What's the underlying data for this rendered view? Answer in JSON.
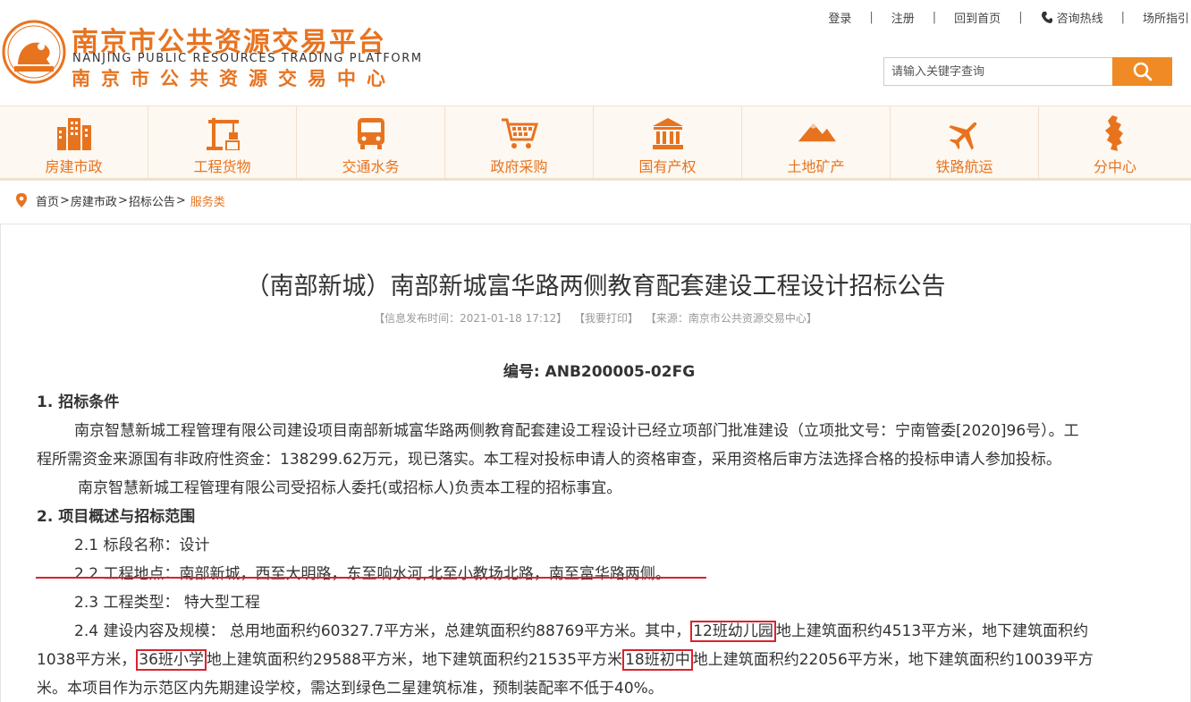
{
  "header": {
    "logo_cn": "南京市公共资源交易平台",
    "logo_en": "NANJING PUBLIC RESOURCES TRADING PLATFORM",
    "logo_sub": "南京市公共资源交易中心",
    "links": {
      "login": "登录",
      "register": "注册",
      "home": "回到首页",
      "hotline": "咨询热线",
      "guide": "场所指引",
      "separator": "|"
    },
    "search_placeholder": "请输入关键字查询"
  },
  "nav": {
    "items": [
      {
        "label": "房建市政",
        "icon": "buildings-icon"
      },
      {
        "label": "工程货物",
        "icon": "crane-icon"
      },
      {
        "label": "交通水务",
        "icon": "bus-icon"
      },
      {
        "label": "政府采购",
        "icon": "cart-icon"
      },
      {
        "label": "国有产权",
        "icon": "bank-icon"
      },
      {
        "label": "土地矿产",
        "icon": "mountain-icon"
      },
      {
        "label": "铁路航运",
        "icon": "plane-icon"
      },
      {
        "label": "分中心",
        "icon": "city-map-icon"
      }
    ]
  },
  "breadcrumb": {
    "home": "首页",
    "level1": "房建市政",
    "level2": "招标公告",
    "current": "服务类",
    "arrow": ">"
  },
  "article": {
    "title": "（南部新城）南部新城富华路两侧教育配套建设工程设计招标公告",
    "meta_time": "【信息发布时间：2021-01-18 17:12】",
    "meta_print": "【我要打印】",
    "meta_source": "【来源：南京市公共资源交易中心】",
    "code": "编号: ANB200005-02FG",
    "s1_heading": "1. 招标条件",
    "s1_p1_line1": "南京智慧新城工程管理有限公司建设项目南部新城富华路两侧教育配套建设工程设计已经立项部门批准建设（立项批文号：宁南管委[2020]96号）。工",
    "s1_p1_line2": "程所需资金来源国有非政府性资金：138299.62万元，现已落实。本工程对投标申请人的资格审查，采用资格后审方法选择合格的投标申请人参加投标。",
    "s1_p2": "南京智慧新城工程管理有限公司受招标人委托(或招标人)负责本工程的招标事宜。",
    "s2_heading": "2. 项目概述与招标范围",
    "s2_1": "2.1 标段名称：设计",
    "s2_2_prefix": "2.2 ",
    "s2_2_text": "工程地点：南部新城，西至大明路，东至响水河,北至小教场北路，南至富华路两侧。",
    "s2_3": "2.3 工程类型： 特大型工程",
    "s2_4_a": "2.4 建设内容及规模： 总用地面积约60327.7平方米，总建筑面积约88769平方米。其中，",
    "s2_4_hl1": "12班幼儿园",
    "s2_4_b": "地上建筑面积约4513平方米，地下建筑面积约",
    "s2_4_c": "1038平方米，",
    "s2_4_hl2": "36班小学",
    "s2_4_d": "地上建筑面积约29588平方米，地下建筑面积约21535平方米",
    "s2_4_hl3": "18班初中",
    "s2_4_e": "地上建筑面积约22056平方米，地下建筑面积约10039平方",
    "s2_4_f": "米。本项目作为示范区内先期建设学校，需达到绿色二星建筑标准，预制装配率不低于40%。"
  },
  "colors": {
    "brand_orange": "#e8731f",
    "search_button": "#f08a24",
    "annotation_red": "#d9232e"
  }
}
